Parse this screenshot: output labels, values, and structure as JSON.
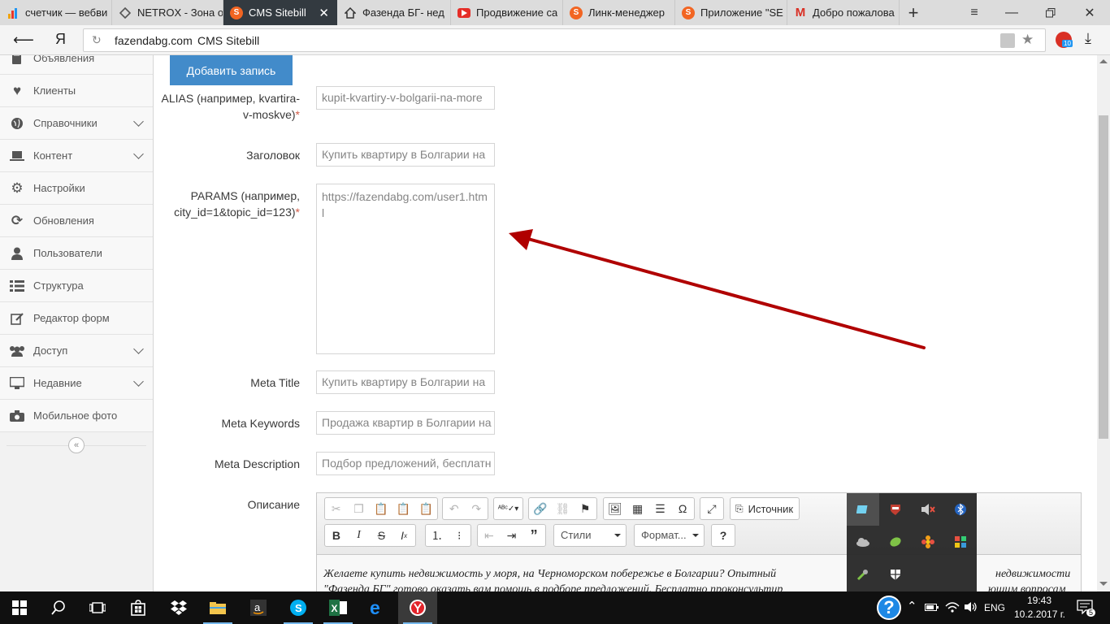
{
  "browser": {
    "tabs": [
      {
        "title": "счетчик — вебви",
        "favicon": "bar-chart-icon",
        "color": "#f0a30a"
      },
      {
        "title": "NETROX - Зона о",
        "favicon": "diamond-icon",
        "color": "#555555"
      },
      {
        "title": "CMS Sitebill",
        "favicon": "s-logo-icon",
        "color": "#f26522",
        "active": true
      },
      {
        "title": "Фазенда БГ- нед",
        "favicon": "house-icon",
        "color": "#333333"
      },
      {
        "title": "Продвижение са",
        "favicon": "youtube-icon",
        "color": "#e52d27"
      },
      {
        "title": "Линк-менеджер",
        "favicon": "s-logo-icon",
        "color": "#f26522"
      },
      {
        "title": "Приложение \"SE",
        "favicon": "s-logo-icon",
        "color": "#f26522"
      },
      {
        "title": "Добро пожалова",
        "favicon": "gmail-icon",
        "color": "#d93025"
      }
    ],
    "url_host": "fazendabg.com",
    "url_title": "CMS Sitebill",
    "yandex_label": "Я",
    "ext_badge": "10"
  },
  "sidebar": {
    "items": [
      {
        "label": "Объявления",
        "icon": "pencil-book-icon",
        "chevron": false
      },
      {
        "label": "Клиенты",
        "icon": "heart-icon",
        "chevron": false
      },
      {
        "label": "Справочники",
        "icon": "globe-icon",
        "chevron": true
      },
      {
        "label": "Контент",
        "icon": "laptop-icon",
        "chevron": true
      },
      {
        "label": "Настройки",
        "icon": "gear-icon",
        "chevron": false
      },
      {
        "label": "Обновления",
        "icon": "refresh-icon",
        "chevron": false
      },
      {
        "label": "Пользователи",
        "icon": "user-icon",
        "chevron": false
      },
      {
        "label": "Структура",
        "icon": "list-icon",
        "chevron": false
      },
      {
        "label": "Редактор форм",
        "icon": "edit-icon",
        "chevron": false
      },
      {
        "label": "Доступ",
        "icon": "users-icon",
        "chevron": true
      },
      {
        "label": "Недавние",
        "icon": "monitor-icon",
        "chevron": true
      },
      {
        "label": "Мобильное фото",
        "icon": "camera-icon",
        "chevron": false
      }
    ],
    "collapse_glyph": "«"
  },
  "form": {
    "add_button": "Добавить запись",
    "fields": {
      "alias": {
        "label": "ALIAS (например, kvartira-v-moskve)",
        "required": "*",
        "value": "kupit-kvartiry-v-bolgarii-na-more"
      },
      "title": {
        "label": "Заголовок",
        "value": "Купить квартиру в Болгарии на"
      },
      "params": {
        "label": "PARAMS (например, city_id=1&topic_id=123)",
        "required": "*",
        "value": "https://fazendabg.com/user1.html"
      },
      "meta_title": {
        "label": "Meta Title",
        "value": "Купить квартиру в Болгарии на"
      },
      "meta_keywords": {
        "label": "Meta Keywords",
        "value": "Продажа квартир в Болгарии на"
      },
      "meta_description": {
        "label": "Meta Description",
        "value": "Подбор предложений, бесплатн"
      },
      "description": {
        "label": "Описание"
      }
    },
    "editor": {
      "source_label": "Источник",
      "styles_label": "Стили",
      "format_label": "Формат...",
      "help_label": "?",
      "content_line1": "Желаете купить недвижимость у моря, на Черноморском побережье в Болгарии? Опытный",
      "content_line1_end": "недвижимости",
      "content_line2": "\"Фазенда БГ\" готово оказать вам помощь в подборе предложений. Бесплатно проконсультир",
      "content_line2_end": "ющим вопросам"
    }
  },
  "annotation": {
    "arrow_color": "#b00000"
  },
  "taskbar": {
    "language": "ENG",
    "time": "19:43",
    "date": "10.2.2017 г.",
    "notification_count": "5"
  }
}
